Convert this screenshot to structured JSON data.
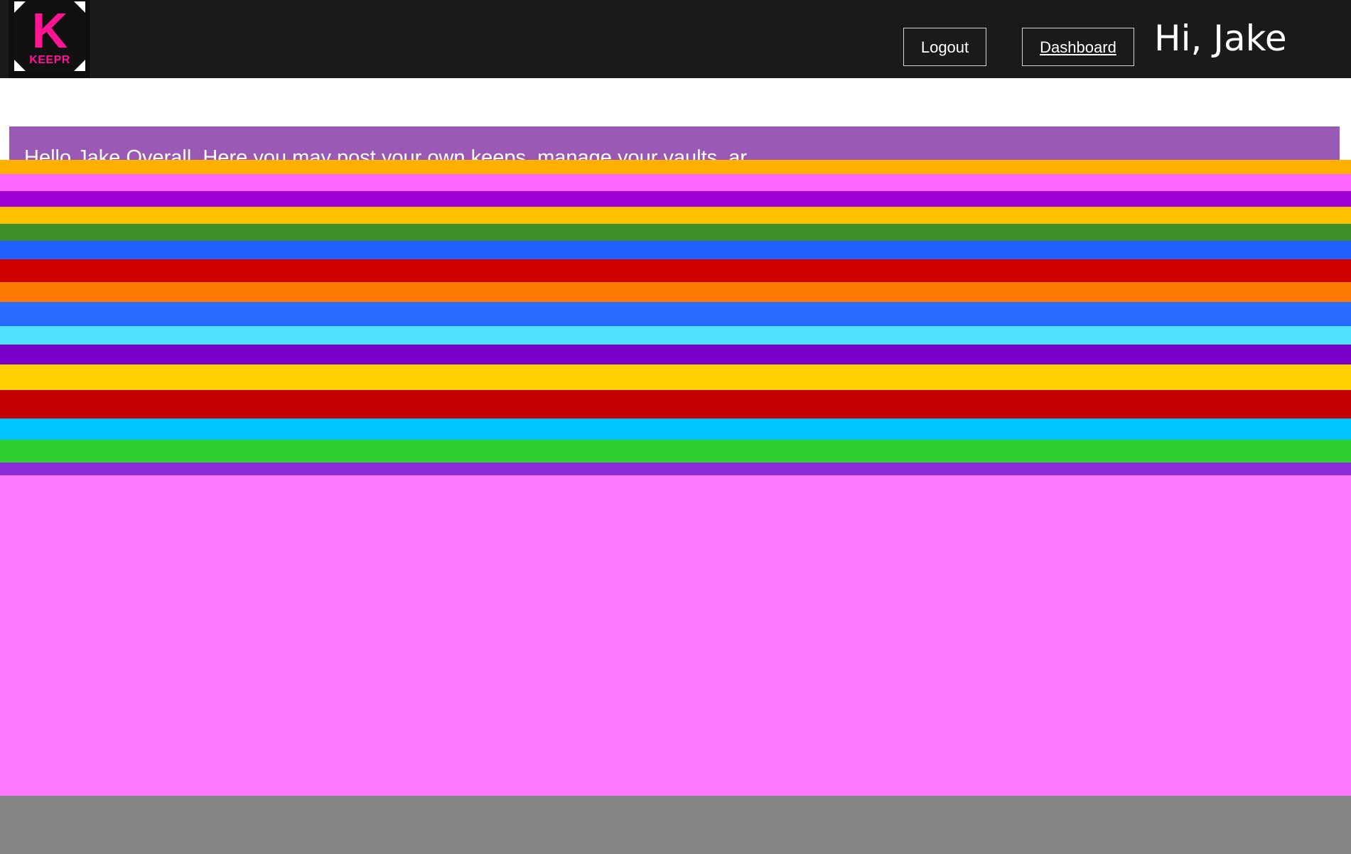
{
  "header": {
    "logo": {
      "letter": "K",
      "wordmark": "KEEPR"
    },
    "logout_label": "Logout",
    "dashboard_label": "Dashboard",
    "greeting": "Hi, Jake"
  },
  "main": {
    "welcome_text": "Hello Jake Overall. Here you may post your own keeps, manage your vaults, ar"
  },
  "colors": {
    "navbar": "#1a1a1a",
    "logo_accent": "#ff1493",
    "banner": "#9b59b6",
    "content_background": "#ff79ff",
    "footer": "#858585"
  }
}
